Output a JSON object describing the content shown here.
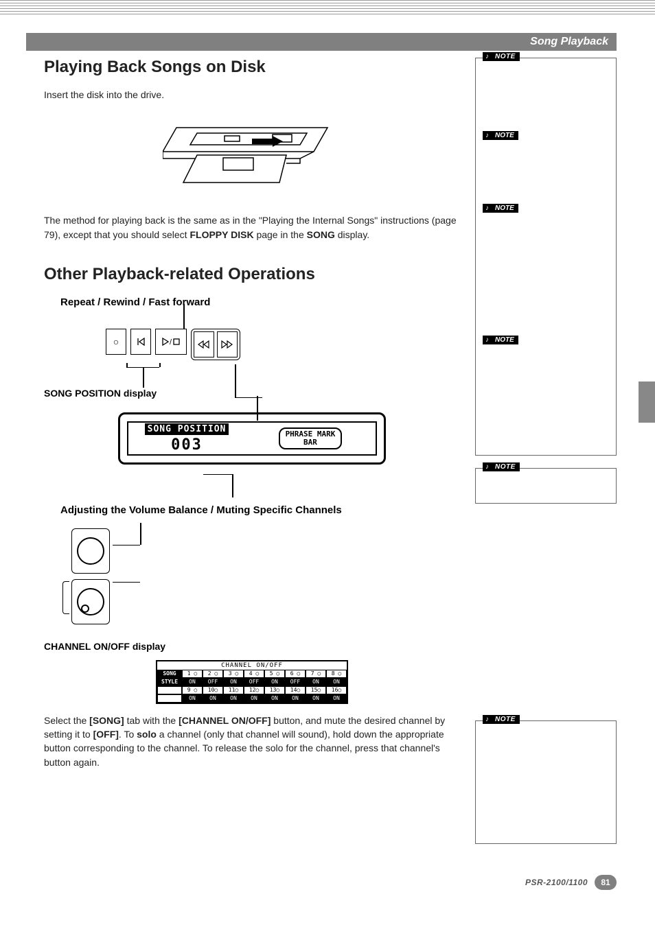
{
  "header": {
    "section_title": "Song Playback"
  },
  "sec1": {
    "heading": "Playing Back Songs on Disk",
    "intro": "Insert the disk into the drive.",
    "method_prefix": "The method for playing back is the same as in the \"Playing the Internal Songs\" instructions (page 79), except that you should select ",
    "method_bold1": "FLOPPY DISK",
    "method_mid": " page in the ",
    "method_bold2": "SONG",
    "method_suffix": " display."
  },
  "sec2": {
    "heading": "Other Playback-related Operations",
    "sub_repeat": "Repeat / Rewind / Fast forward",
    "song_pos_label": "SONG POSITION display",
    "lcd_title": "SONG POSITION",
    "lcd_value": "003",
    "phrase_line1": "PHRASE MARK",
    "phrase_line2": "BAR",
    "sub_volume": "Adjusting the Volume Balance / Muting Specific Channels",
    "channel_label": "CHANNEL ON/OFF display"
  },
  "channel_table": {
    "title": "CHANNEL ON/OFF",
    "left_labels": [
      "SONG",
      "STYLE"
    ],
    "row1_nums": [
      "1 ○",
      "2 ○",
      "3 ○",
      "4 ○",
      "5 ○",
      "6 ○",
      "7 ○",
      "8 ○"
    ],
    "row1_vals": [
      "ON",
      "OFF",
      "ON",
      "OFF",
      "ON",
      "OFF",
      "ON",
      "ON"
    ],
    "row2_nums": [
      "9 ○",
      "10○",
      "11○",
      "12○",
      "13○",
      "14○",
      "15○",
      "16○"
    ],
    "row2_vals": [
      "ON",
      "ON",
      "ON",
      "ON",
      "ON",
      "ON",
      "ON",
      "ON"
    ]
  },
  "channel_text": {
    "p1_a": "Select the ",
    "p1_b": "[SONG]",
    "p1_c": " tab with the ",
    "p1_d": "[CHANNEL ON/OFF]",
    "p1_e": " button, and mute the desired channel by setting it to ",
    "p1_f": "[OFF]",
    "p1_g": ". To ",
    "p1_h": "solo",
    "p1_i": " a channel (only that channel will sound), hold down the appropriate button corresponding to the channel. To release the solo for the channel, press that channel's button again."
  },
  "notes": {
    "label": "NOTE"
  },
  "footer": {
    "model": "PSR-2100/1100",
    "page": "81"
  }
}
